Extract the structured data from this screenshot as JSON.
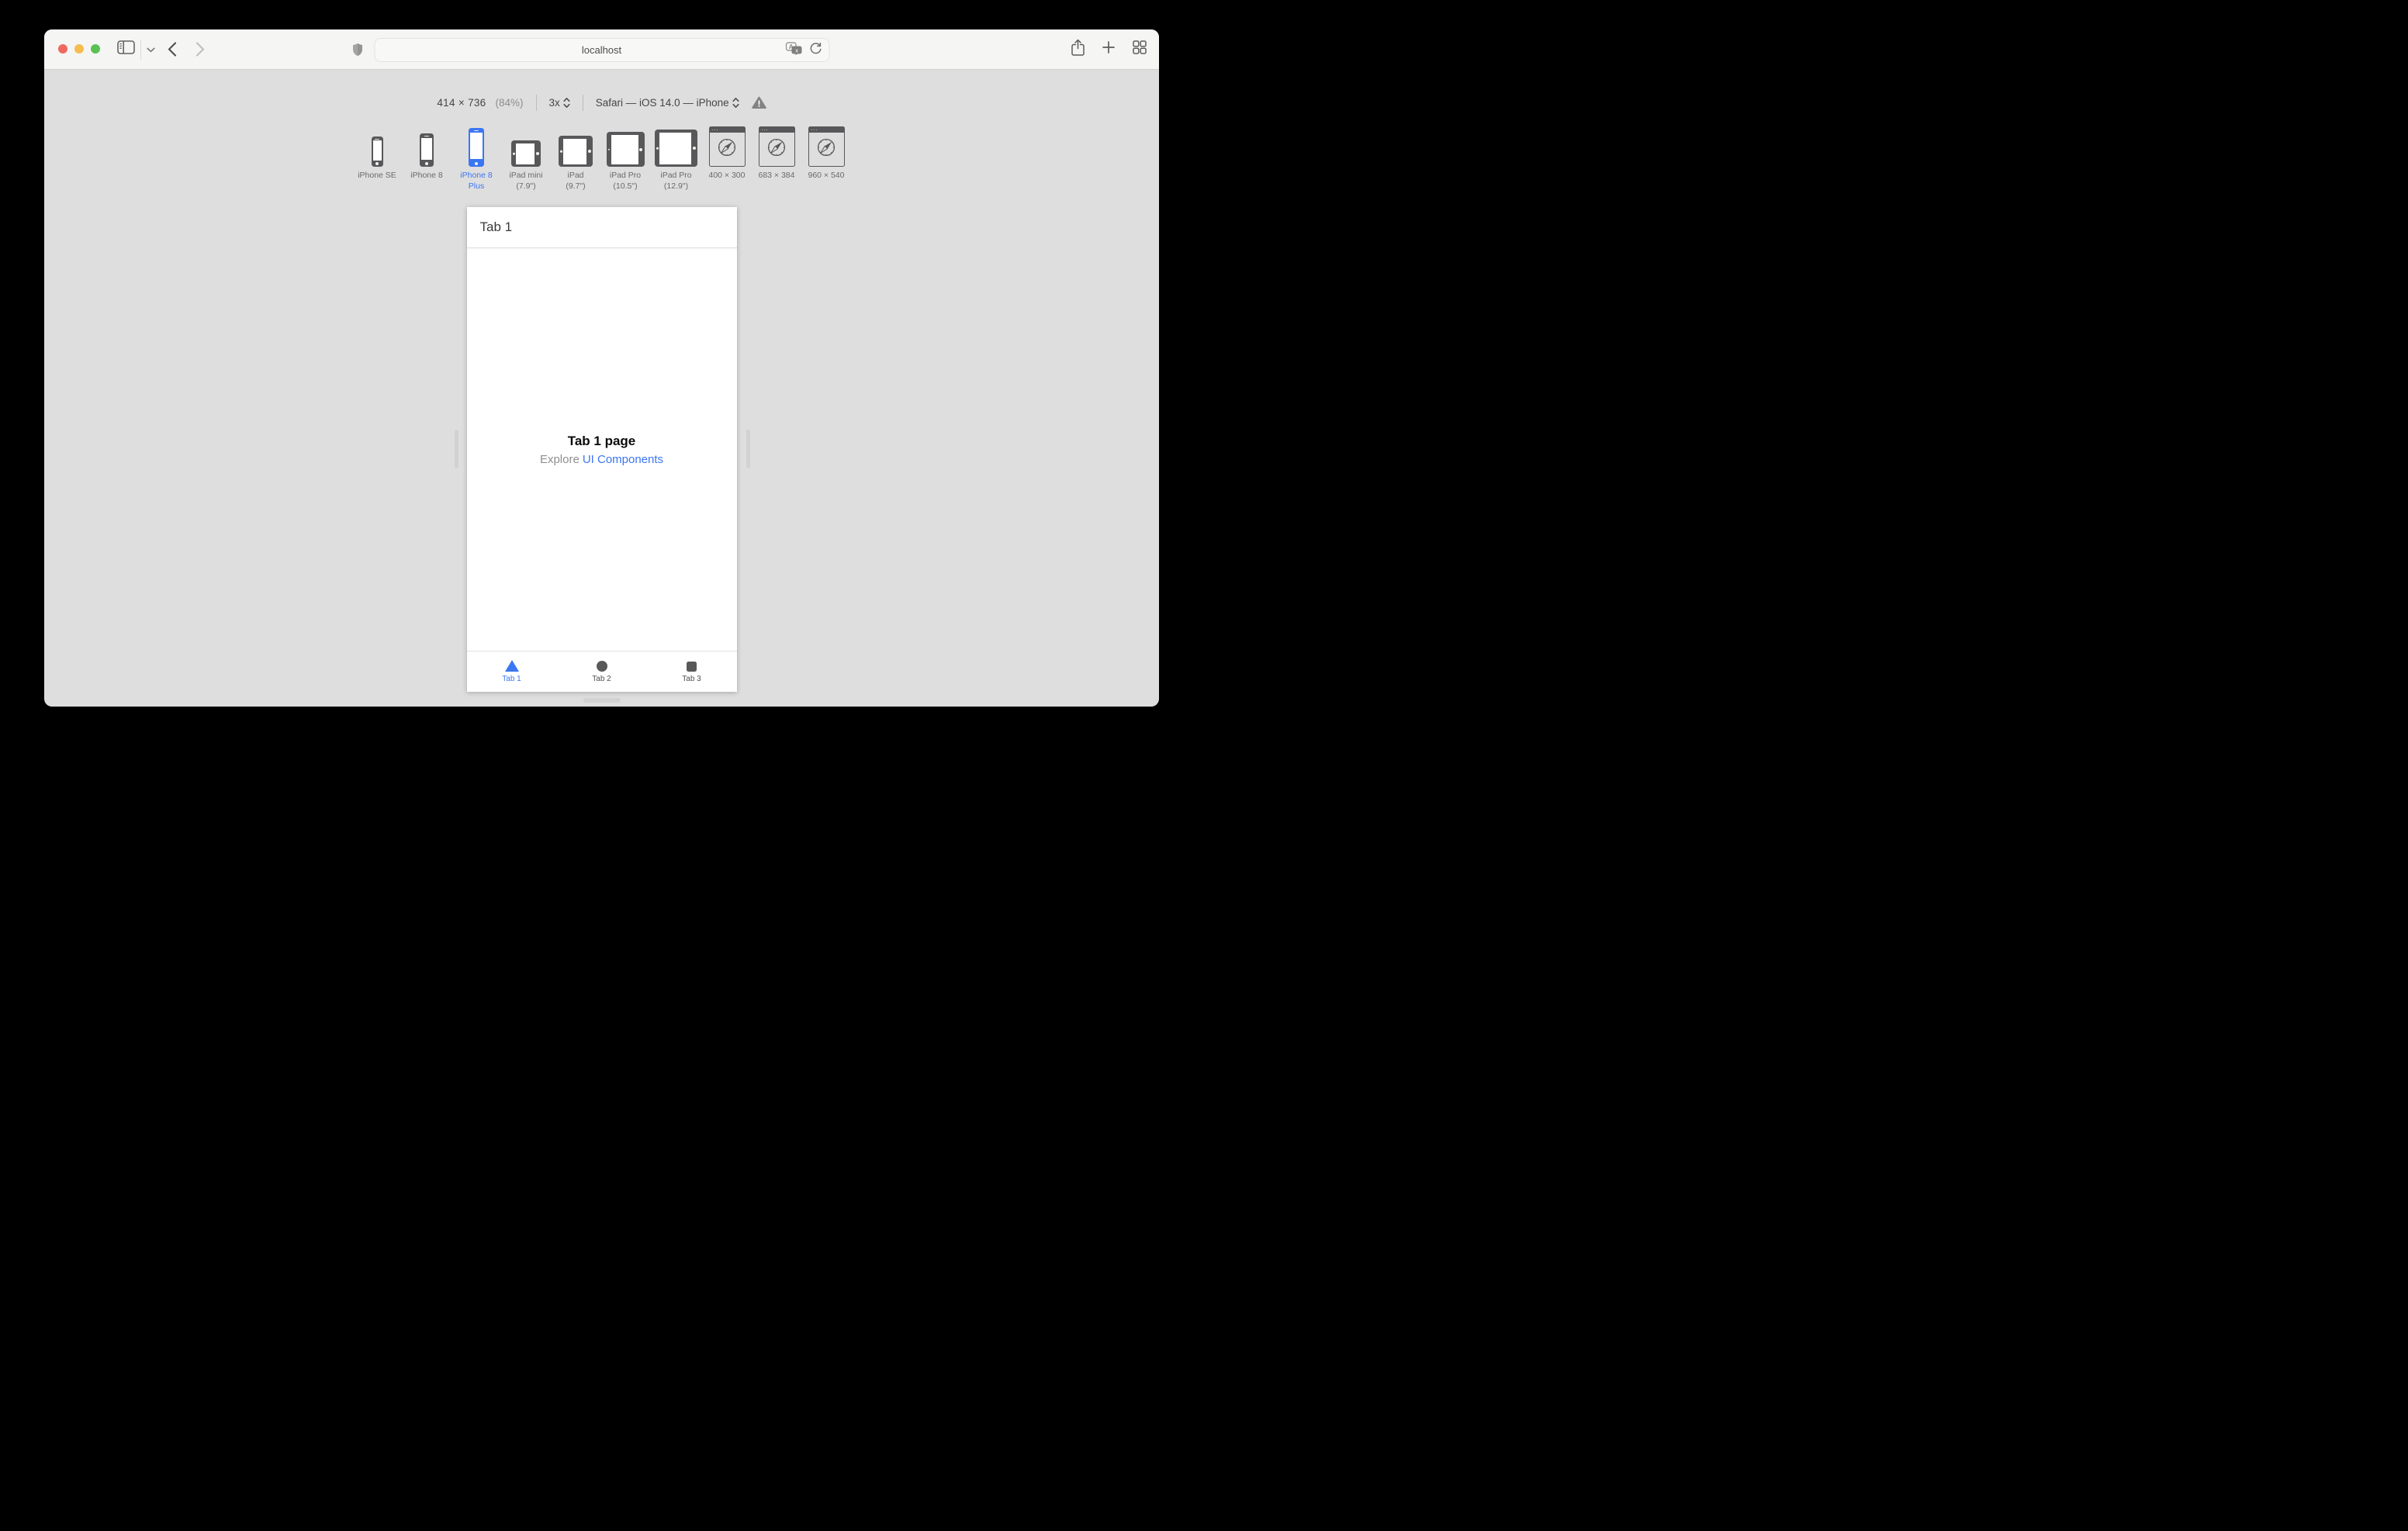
{
  "colors": {
    "accent_blue": "#3b76f3",
    "toolbar_bg": "#f5f5f4",
    "content_bg": "#dedede",
    "device_gray": "#58585a",
    "traffic_red": "#ee6a5f",
    "traffic_yellow": "#f5bd4e",
    "traffic_green": "#5bc152"
  },
  "toolbar": {
    "url": "localhost",
    "icons": {
      "sidebar": "sidebar-toggle-icon",
      "sidebar_menu": "chevron-down-icon",
      "back": "back-arrow-icon",
      "forward": "forward-arrow-icon",
      "privacy": "shield-icon",
      "translate": "translate-icon",
      "reload": "reload-icon",
      "share": "share-icon",
      "new_tab": "plus-icon",
      "tab_overview": "grid-icon"
    }
  },
  "rdm": {
    "dimensions": "414 × 736",
    "zoom": "(84%)",
    "scale": "3x",
    "browser_profile": "Safari — iOS 14.0 — iPhone",
    "warning": "warning-triangle-icon"
  },
  "devices": [
    {
      "label": "iPhone SE",
      "selected": false
    },
    {
      "label": "iPhone 8",
      "selected": false
    },
    {
      "label": "iPhone 8\nPlus",
      "selected": true
    },
    {
      "label": "iPad mini\n(7.9\")",
      "selected": false
    },
    {
      "label": "iPad\n(9.7\")",
      "selected": false
    },
    {
      "label": "iPad Pro\n(10.5\")",
      "selected": false
    },
    {
      "label": "iPad Pro\n(12.9\")",
      "selected": false
    },
    {
      "label": "400 × 300",
      "selected": false
    },
    {
      "label": "683 × 384",
      "selected": false
    },
    {
      "label": "960 × 540",
      "selected": false
    }
  ],
  "phone": {
    "nav_title": "Tab 1",
    "page_title": "Tab 1 page",
    "subtitle_prefix": "Explore",
    "subtitle_link": "UI Components",
    "tab_bar": [
      {
        "label": "Tab 1",
        "icon": "triangle",
        "active": true
      },
      {
        "label": "Tab 2",
        "icon": "circle",
        "active": false
      },
      {
        "label": "Tab 3",
        "icon": "square",
        "active": false
      }
    ]
  }
}
